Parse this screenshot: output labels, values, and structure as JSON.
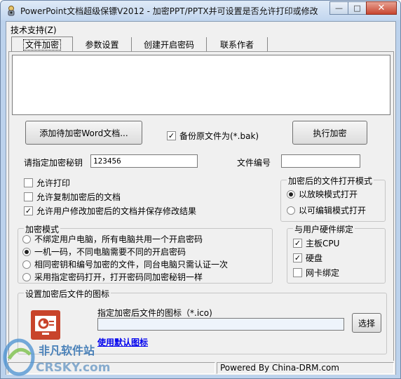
{
  "window": {
    "title": "PowerPoint文档超级保镖V2012 - 加密PPT/PPTX并可设置是否允许打印或修改",
    "minimize_icon": "minimize-icon",
    "maximize_icon": "maximize-icon",
    "close_icon": "close-icon",
    "minimize_glyph": "—",
    "maximize_glyph": "□",
    "close_glyph": "✕"
  },
  "menu": {
    "item": "技术支持(Z)"
  },
  "tabs": [
    {
      "label": "文件加密",
      "active": true
    },
    {
      "label": "参数设置"
    },
    {
      "label": "创建开启密码"
    },
    {
      "label": "联系作者"
    }
  ],
  "actions": {
    "add_button": "添加待加密Word文档...",
    "backup_checkbox": "备份原文件为(*.bak)",
    "backup_checked": true,
    "execute_button": "执行加密",
    "checked_glyph": "✓"
  },
  "key": {
    "label": "请指定加密秘钥",
    "value": "123456"
  },
  "file_no": {
    "label": "文件编号",
    "value": ""
  },
  "permissions": [
    {
      "label": "允许打印",
      "checked": false
    },
    {
      "label": "允许复制加密后的文档",
      "checked": false
    },
    {
      "label": "允许用户修改加密后的文档并保存修改结果",
      "checked": true
    }
  ],
  "open_mode": {
    "title": "加密后的文件打开模式",
    "options": [
      {
        "label": "以放映模式打开",
        "selected": true
      },
      {
        "label": "以可编辑模式打开",
        "selected": false
      }
    ]
  },
  "encrypt_mode": {
    "title": "加密模式",
    "options": [
      {
        "label": "不绑定用户电脑，所有电脑共用一个开启密码",
        "selected": false
      },
      {
        "label": "一机一码，不同电脑需要不同的开启密码",
        "selected": true
      },
      {
        "label": "相同密钥和编号加密的文件，同台电脑只需认证一次",
        "selected": false
      },
      {
        "label": "采用指定密码打开，打开密码同加密秘钥一样",
        "selected": false
      }
    ]
  },
  "hardware": {
    "title": "与用户硬件绑定",
    "options": [
      {
        "label": "主板CPU",
        "checked": true
      },
      {
        "label": "硬盘",
        "checked": true
      },
      {
        "label": "网卡绑定",
        "checked": false
      }
    ]
  },
  "icon_section": {
    "title": "设置加密后文件的图标",
    "field_label": "指定加密后文件的图标（*.ico)",
    "field_value": "",
    "browse_button": "选择",
    "default_link": "使用默认图标",
    "preview_icon": "powerpoint-file-icon"
  },
  "status": {
    "powered_by": "Powered By China-DRM.com"
  },
  "watermark": {
    "brand": "非凡软件站",
    "domain": "CRSKY.com"
  },
  "colors": {
    "accent": "#0000ee",
    "ppt_icon": "#c8442b"
  }
}
